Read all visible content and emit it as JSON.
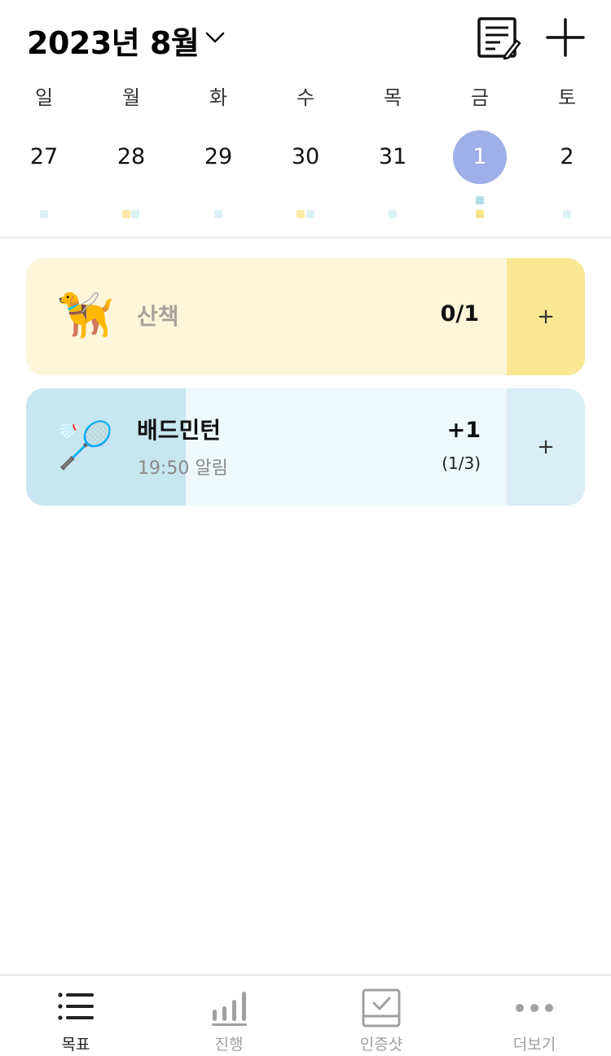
{
  "header": {
    "month_title": "2023년 8월",
    "icons": {
      "chevron": "chevron-down-icon",
      "memo": "memo-list-icon",
      "add": "plus-icon"
    }
  },
  "calendar": {
    "weekdays": [
      "일",
      "월",
      "화",
      "수",
      "목",
      "금",
      "토"
    ],
    "dates": [
      "27",
      "28",
      "29",
      "30",
      "31",
      "1",
      "2"
    ],
    "selected_index": 5,
    "selected_color": "#9fb0e8",
    "marker_colors": {
      "walk": "#f8e793",
      "badminton": "#c7e6f0"
    }
  },
  "goals": [
    {
      "emoji": "🦮",
      "title": "산책",
      "count": "0/1",
      "plus": "+",
      "bg_color": "#fdf6da",
      "accent_color": "#f8e793"
    },
    {
      "emoji": "🏸",
      "title": "배드민턴",
      "subtitle": "19:50 알림",
      "count": "+1",
      "count_detail": "(1/3)",
      "plus": "+",
      "progress_fraction": 0.333,
      "bg_color": "#eff8fb",
      "accent_color": "#c7e6f0"
    }
  ],
  "tabbar": {
    "tabs": [
      {
        "label": "목표",
        "icon": "list-icon",
        "active": true
      },
      {
        "label": "진행",
        "icon": "bar-chart-icon",
        "active": false
      },
      {
        "label": "인증샷",
        "icon": "photo-check-icon",
        "active": false
      },
      {
        "label": "더보기",
        "icon": "more-dots-icon",
        "active": false
      }
    ]
  }
}
